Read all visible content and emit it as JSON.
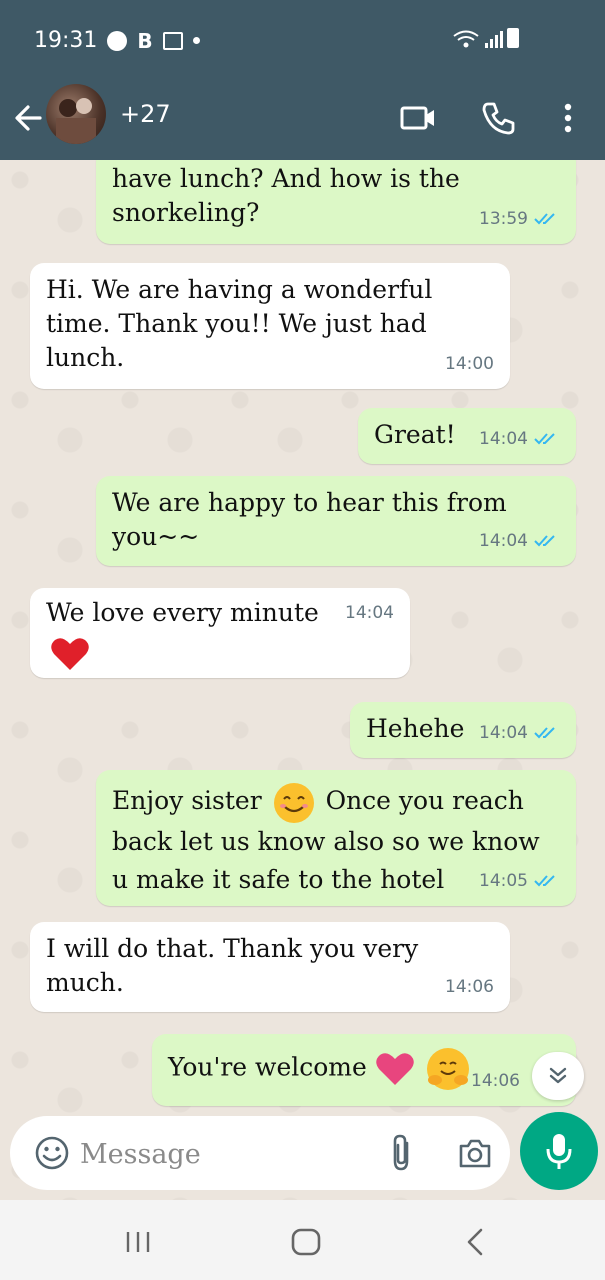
{
  "status_bar": {
    "time": "19:31",
    "b_label": "B"
  },
  "header": {
    "contact_name": "+27"
  },
  "messages": [
    {
      "dir": "out",
      "text": "have lunch? And how is the snorkeling?",
      "time": "13:59",
      "ticks": "read"
    },
    {
      "dir": "in",
      "text": "Hi. We are having a wonderful time. Thank you!! We just had lunch.",
      "time": "14:00"
    },
    {
      "dir": "out",
      "text": "Great!",
      "time": "14:04",
      "ticks": "read"
    },
    {
      "dir": "out",
      "text": "We are happy to hear this from you~~",
      "time": "14:04",
      "ticks": "read"
    },
    {
      "dir": "in",
      "text": "We love every minute",
      "time": "14:04",
      "emoji": "red-heart"
    },
    {
      "dir": "out",
      "text": "Hehehe",
      "time": "14:04",
      "ticks": "read"
    },
    {
      "dir": "out",
      "text_a": "Enjoy sister",
      "text_b": "Once you reach back let us know also so we know u make it safe to the hotel",
      "time": "14:05",
      "ticks": "read",
      "emoji": "smiling-face"
    },
    {
      "dir": "in",
      "text": "I will do that. Thank you very much.",
      "time": "14:06"
    },
    {
      "dir": "out",
      "text": "You're welcome",
      "time": "14:06",
      "ticks": "read",
      "emoji": [
        "pink-heart",
        "hugging-face"
      ]
    }
  ],
  "input": {
    "placeholder": "Message"
  },
  "colors": {
    "header_bg": "#3f5966",
    "outgoing_bubble": "#dcf8c6",
    "incoming_bubble": "#ffffff",
    "read_tick": "#34b7f1",
    "mic_button": "#00a884"
  },
  "icons": {
    "header": [
      "back-arrow-icon",
      "video-call-icon",
      "phone-icon",
      "more-vertical-icon"
    ],
    "input": [
      "emoji-icon",
      "attach-icon",
      "camera-icon",
      "mic-icon"
    ],
    "nav": [
      "recents-icon",
      "home-icon",
      "back-icon"
    ]
  }
}
